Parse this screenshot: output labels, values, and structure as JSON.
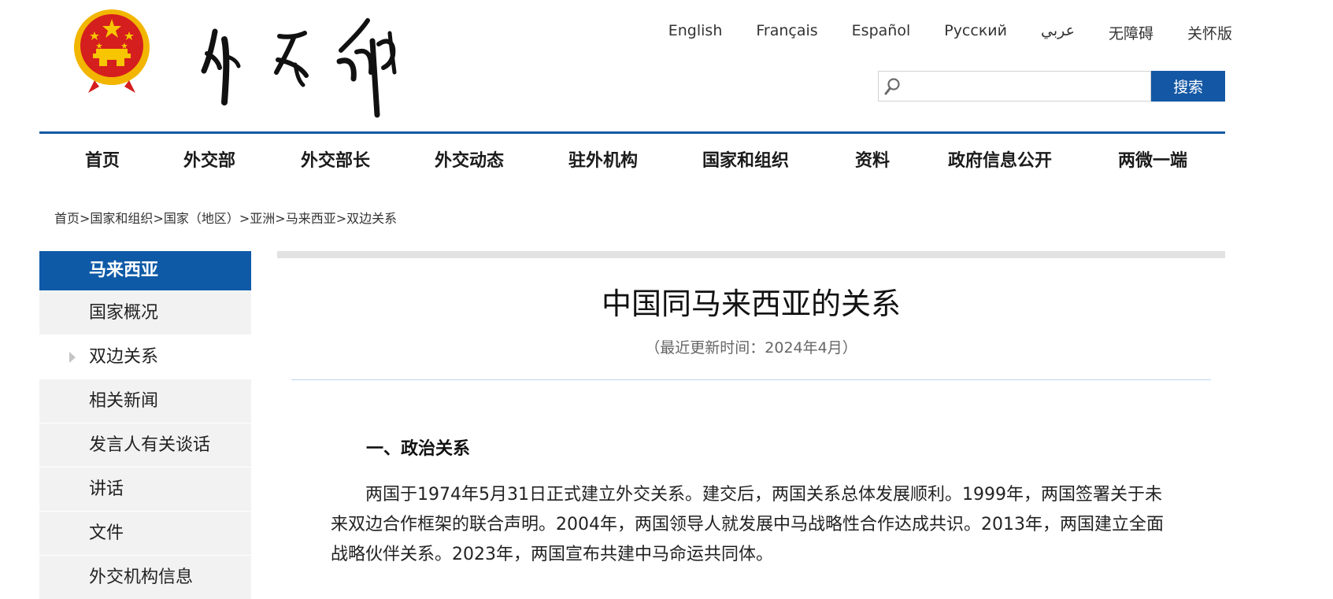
{
  "header": {
    "languages": [
      "English",
      "Français",
      "Español",
      "Русский",
      "عربي",
      "无障碍",
      "关怀版"
    ],
    "search": {
      "placeholder": "",
      "value": "",
      "button_label": "搜索"
    }
  },
  "nav": {
    "items": [
      "首页",
      "外交部",
      "外交部长",
      "外交动态",
      "驻外机构",
      "国家和组织",
      "资料",
      "政府信息公开",
      "两微一端"
    ]
  },
  "breadcrumb": {
    "items": [
      "首页",
      "国家和组织",
      "国家（地区）",
      "亚洲",
      "马来西亚",
      "双边关系"
    ],
    "separator": ">"
  },
  "sidebar": {
    "title": "马来西亚",
    "items": [
      "国家概况",
      "双边关系",
      "相关新闻",
      "发言人有关谈话",
      "讲话",
      "文件",
      "外交机构信息"
    ],
    "active_index": 1
  },
  "article": {
    "title": "中国同马来西亚的关系",
    "updated": "（最近更新时间：2024年4月）",
    "section_heading": "一、政治关系",
    "paragraph": "两国于1974年5月31日正式建立外交关系。建交后，两国关系总体发展顺利。1999年，两国签署关于未来双边合作框架的联合声明。2004年，两国领导人就发展中马战略性合作达成共识。2013年，两国建立全面战略伙伴关系。2023年，两国宣布共建中马命运共同体。"
  },
  "colors": {
    "brand_blue": "#1458a5",
    "sidebar_title_bg": "#0f5aa7",
    "sidebar_item_bg": "#f2f2f2",
    "emblem_red": "#d51e1e",
    "emblem_gold": "#f2b600"
  },
  "icons": {
    "search": "search-icon",
    "emblem": "national-emblem-logo",
    "calligraphy": "ministry-calligraphy-logo",
    "sidebar_marker": "triangle-right-icon"
  }
}
